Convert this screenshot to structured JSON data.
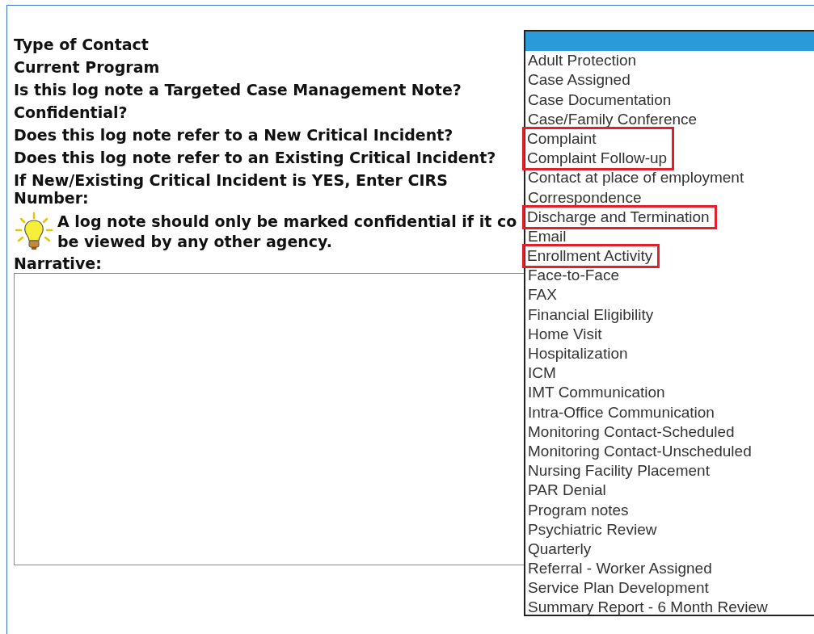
{
  "form": {
    "labels": [
      {
        "text": "Type of Contact"
      },
      {
        "text": "Current Program"
      },
      {
        "text": "Is this log note a Targeted Case Management Note?"
      },
      {
        "text": "Confidential?"
      },
      {
        "text": "Does this log note refer to a New Critical Incident?"
      },
      {
        "text": "Does this log note refer to an Existing Critical Incident?"
      },
      {
        "text": "If New/Existing Critical Incident is YES, Enter CIRS Number:"
      }
    ],
    "tip": {
      "lines": [
        "A log note should only be marked confidential if it co",
        "be viewed by any other agency."
      ]
    },
    "narrative": {
      "label": "Narrative:"
    }
  },
  "dropdown": {
    "options": [
      {
        "selected": true,
        "highlighted": false
      },
      {
        "label": "Adult Protection",
        "selected": false,
        "highlighted": false
      },
      {
        "label": "Case Assigned",
        "selected": false,
        "highlighted": false
      },
      {
        "label": "Case Documentation",
        "selected": false,
        "highlighted": false
      },
      {
        "label": "Case/Family Conference",
        "selected": false,
        "highlighted": false
      },
      {
        "label": "Complaint",
        "selected": false,
        "highlighted": true
      },
      {
        "label": "Complaint Follow-up",
        "selected": false,
        "highlighted": true
      },
      {
        "label": "Contact at place of employment",
        "selected": false,
        "highlighted": false
      },
      {
        "label": "Correspondence",
        "selected": false,
        "highlighted": false
      },
      {
        "label": "Discharge and Termination",
        "selected": false,
        "highlighted": true
      },
      {
        "label": "Email",
        "selected": false,
        "highlighted": false
      },
      {
        "label": "Enrollment Activity",
        "selected": false,
        "highlighted": true
      },
      {
        "label": "Face-to-Face",
        "selected": false,
        "highlighted": false
      },
      {
        "label": "FAX",
        "selected": false,
        "highlighted": false
      },
      {
        "label": "Financial Eligibility",
        "selected": false,
        "highlighted": false
      },
      {
        "label": "Home Visit",
        "selected": false,
        "highlighted": false
      },
      {
        "label": "Hospitalization",
        "selected": false,
        "highlighted": false
      },
      {
        "label": "ICM",
        "selected": false,
        "highlighted": false
      },
      {
        "label": "IMT Communication",
        "selected": false,
        "highlighted": false
      },
      {
        "label": "Intra-Office Communication",
        "selected": false,
        "highlighted": false
      },
      {
        "label": "Monitoring Contact-Scheduled",
        "selected": false,
        "highlighted": false
      },
      {
        "label": "Monitoring Contact-Unscheduled",
        "selected": false,
        "highlighted": false
      },
      {
        "label": "Nursing Facility Placement",
        "selected": false,
        "highlighted": false
      },
      {
        "label": "PAR Denial",
        "selected": false,
        "highlighted": false
      },
      {
        "label": "Program notes",
        "selected": false,
        "highlighted": false
      },
      {
        "label": "Psychiatric Review",
        "selected": false,
        "highlighted": false
      },
      {
        "label": "Quarterly",
        "selected": false,
        "highlighted": false
      },
      {
        "label": "Referral - Worker Assigned",
        "selected": false,
        "highlighted": false
      },
      {
        "label": "Service Plan Development",
        "selected": false,
        "highlighted": false
      },
      {
        "label": "Summary Report - 6 Month Review",
        "selected": false,
        "highlighted": false
      }
    ]
  }
}
